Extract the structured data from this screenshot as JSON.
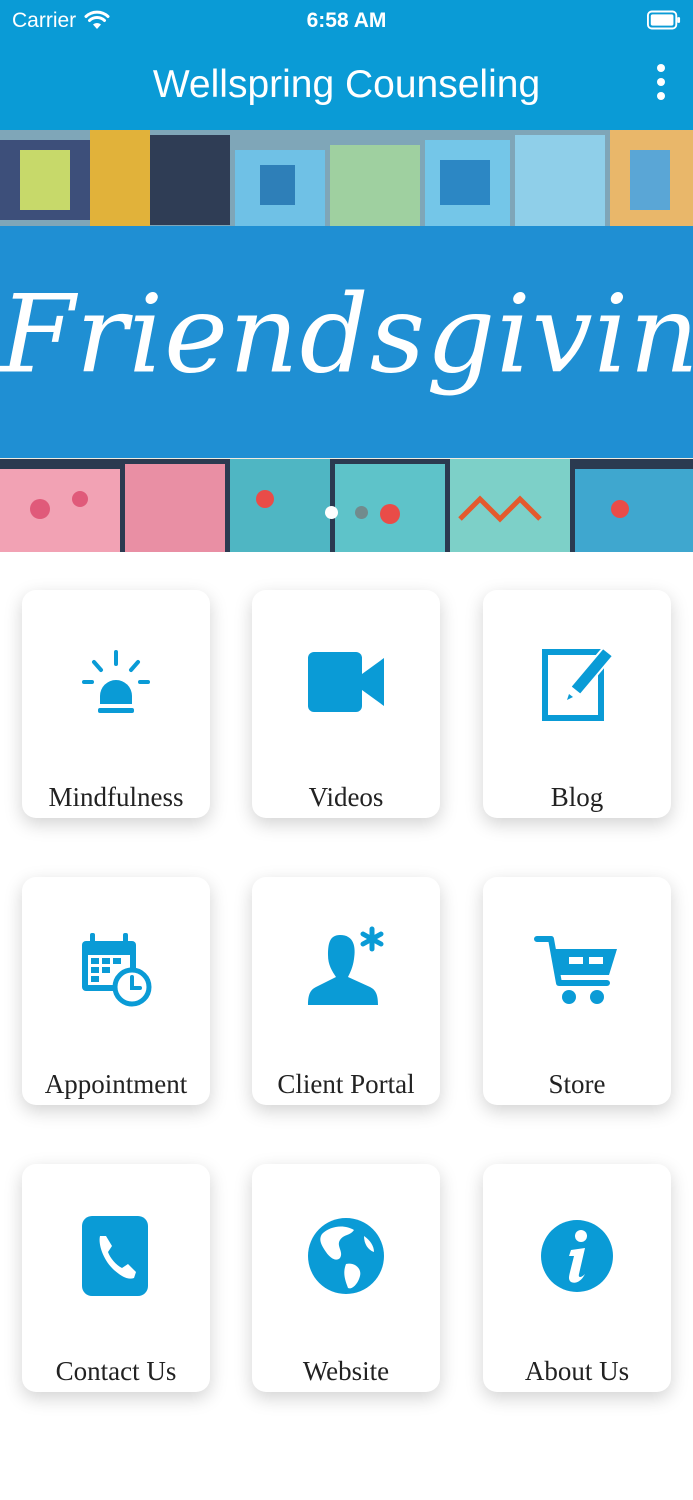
{
  "status_bar": {
    "carrier": "Carrier",
    "time": "6:58 AM"
  },
  "header": {
    "title": "Wellspring Counseling"
  },
  "banner": {
    "text": "Friendsgiving",
    "slide_count": 2,
    "active_slide": 1
  },
  "accent_color": "#0a9bd6",
  "tiles": [
    {
      "label": "Mindfulness",
      "icon": "alarm-light-icon"
    },
    {
      "label": "Videos",
      "icon": "video-camera-icon"
    },
    {
      "label": "Blog",
      "icon": "edit-note-icon"
    },
    {
      "label": "Appointment",
      "icon": "calendar-clock-icon"
    },
    {
      "label": "Client Portal",
      "icon": "user-asterisk-icon"
    },
    {
      "label": "Store",
      "icon": "shopping-cart-icon"
    },
    {
      "label": "Contact Us",
      "icon": "phone-icon"
    },
    {
      "label": "Website",
      "icon": "globe-icon"
    },
    {
      "label": "About Us",
      "icon": "info-icon"
    }
  ]
}
